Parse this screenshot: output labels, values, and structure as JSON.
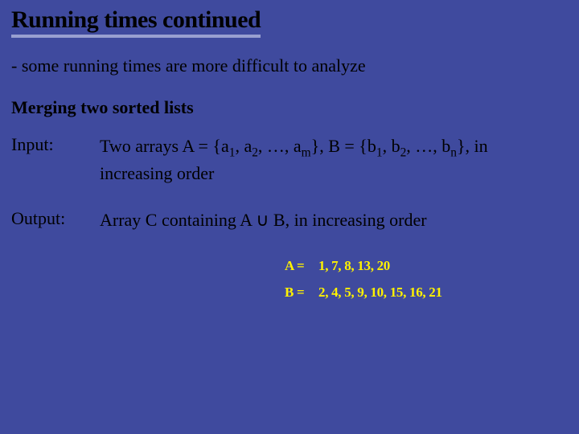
{
  "title": "Running times continued",
  "intro": "- some running times are more difficult to analyze",
  "subtitle": "Merging two sorted lists",
  "input": {
    "label": "Input:",
    "text_pre": "Two arrays A = {a",
    "s1": "1",
    "t2": ", a",
    "s2": "2",
    "t3": ", …, a",
    "s3": "m",
    "t4": "}, B = {b",
    "s4": "1",
    "t5": ", b",
    "s5": "2",
    "t6": ", …, b",
    "s6": "n",
    "t7": "}, in increasing order"
  },
  "output": {
    "label": "Output:",
    "text_pre": "Array C containing A ",
    "cup": "∪",
    "text_post": " B, in increasing order"
  },
  "handwritten": {
    "a_label": "A =",
    "a_vals": "1, 7, 8, 13, 20",
    "b_label": "B =",
    "b_vals": "2, 4, 5, 9, 10, 15, 16, 21"
  }
}
